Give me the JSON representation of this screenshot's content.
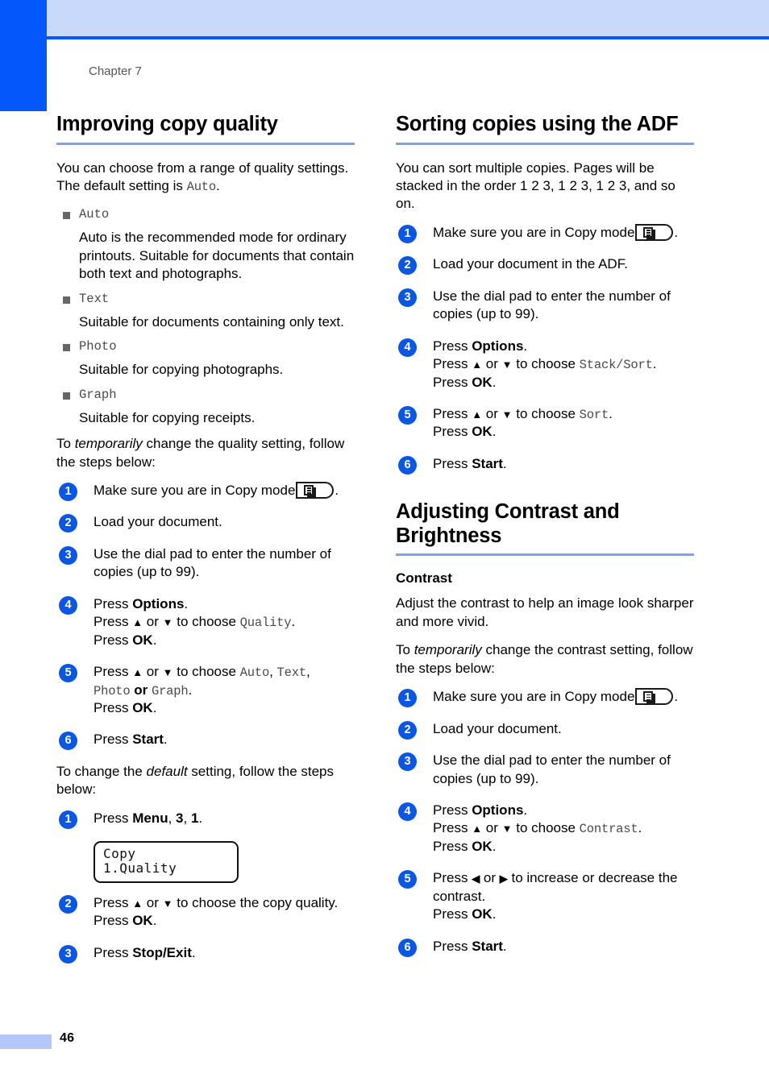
{
  "page": {
    "chapter_label": "Chapter 7",
    "page_number": "46",
    "accent_blue": "#0458fb",
    "header_band_blue": "#c9d9fb",
    "rule_blue": "#7ba3e8",
    "step_circle_blue": "#0b57e3",
    "footer_block_blue": "#b3c8f8"
  },
  "left_column": {
    "heading": "Improving copy quality",
    "intro_a": "You can choose from a range of quality settings. The default setting is ",
    "intro_a_mono": "Auto",
    "intro_a_end": ".",
    "quality_options": [
      {
        "name": "Auto",
        "description": "Auto is the recommended mode for ordinary printouts. Suitable for documents that contain both text and photographs."
      },
      {
        "name": "Text",
        "description": "Suitable for documents containing only text."
      },
      {
        "name": "Photo",
        "description": "Suitable for copying photographs."
      },
      {
        "name": "Graph",
        "description": "Suitable for copying receipts."
      }
    ],
    "temp_intro_pre": "To ",
    "temp_intro_em": "temporarily",
    "temp_intro_post": " change the quality setting, follow the steps below:",
    "temp_steps": {
      "s1": "Make sure you are in Copy mode",
      "s1_end": ".",
      "s2": "Load your document.",
      "s3": "Use the dial pad to enter the number of copies (up to 99).",
      "s4_l1_pre": "Press ",
      "s4_l1_b": "Options",
      "s4_l1_end": ".",
      "s4_l2_pre": "Press ",
      "s4_l2_mid": " or ",
      "s4_l2_post": " to choose ",
      "s4_l2_mono": "Quality",
      "s4_l2_end": ".",
      "s4_l3_pre": "Press ",
      "s4_l3_b": "OK",
      "s4_l3_end": ".",
      "s5_l1_pre": "Press ",
      "s5_l1_mid": " or ",
      "s5_l1_post": " to choose ",
      "s5_mono_1": "Auto",
      "s5_sep_1": ", ",
      "s5_mono_2": "Text",
      "s5_sep_2": ",",
      "s5_l2_mono_3": "Photo",
      "s5_l2_or": " or ",
      "s5_l2_mono_4": "Graph",
      "s5_l2_end": ".",
      "s5_l3_pre": "Press ",
      "s5_l3_b": "OK",
      "s5_l3_end": ".",
      "s6_pre": "Press ",
      "s6_b": "Start",
      "s6_end": "."
    },
    "default_intro_pre": "To change the ",
    "default_intro_em": "default",
    "default_intro_post": " setting, follow the steps below:",
    "default_steps": {
      "d1_pre": "Press ",
      "d1_b1": "Menu",
      "d1_sep1": ", ",
      "d1_b2": "3",
      "d1_sep2": ", ",
      "d1_b3": "1",
      "d1_end": ".",
      "lcd_line1": "Copy",
      "lcd_line2": "1.Quality",
      "d2_l1_pre": "Press ",
      "d2_l1_mid": " or ",
      "d2_l1_post": " to choose the copy quality.",
      "d2_l2_pre": "Press ",
      "d2_l2_b": "OK",
      "d2_l2_end": ".",
      "d3_pre": "Press ",
      "d3_b": "Stop/Exit",
      "d3_end": "."
    }
  },
  "right_column": {
    "heading_sort": "Sorting copies using the ADF",
    "sort_intro": "You can sort multiple copies. Pages will be stacked in the order 1 2 3, 1 2 3, 1 2 3, and so on.",
    "sort_steps": {
      "s1": "Make sure you are in Copy mode",
      "s1_end": ".",
      "s2": "Load your document in the ADF.",
      "s3": "Use the dial pad to enter the number of copies (up to 99).",
      "s4_l1_pre": "Press ",
      "s4_l1_b": "Options",
      "s4_l1_end": ".",
      "s4_l2_pre": "Press ",
      "s4_l2_mid": " or ",
      "s4_l2_post": " to choose ",
      "s4_l2_mono": "Stack/Sort",
      "s4_l2_end": ".",
      "s4_l3_pre": "Press ",
      "s4_l3_b": "OK",
      "s4_l3_end": ".",
      "s5_l1_pre": "Press ",
      "s5_l1_mid": " or ",
      "s5_l1_post": " to choose ",
      "s5_l1_mono": "Sort",
      "s5_l1_end": ".",
      "s5_l2_pre": "Press ",
      "s5_l2_b": "OK",
      "s5_l2_end": ".",
      "s6_pre": "Press ",
      "s6_b": "Start",
      "s6_end": "."
    },
    "heading_contrast": "Adjusting Contrast and Brightness",
    "subheading_contrast": "Contrast",
    "contrast_desc": "Adjust the contrast to help an image look sharper and more vivid.",
    "contrast_temp_pre": "To ",
    "contrast_temp_em": "temporarily",
    "contrast_temp_post": " change the contrast setting, follow the steps below:",
    "contrast_steps": {
      "c1": "Make sure you are in Copy mode",
      "c1_end": ".",
      "c2": "Load your document.",
      "c3": "Use the dial pad to enter the number of copies (up to 99).",
      "c4_l1_pre": "Press ",
      "c4_l1_b": "Options",
      "c4_l1_end": ".",
      "c4_l2_pre": "Press ",
      "c4_l2_mid": " or ",
      "c4_l2_post": " to choose ",
      "c4_l2_mono": "Contrast",
      "c4_l2_end": ".",
      "c4_l3_pre": "Press ",
      "c4_l3_b": "OK",
      "c4_l3_end": ".",
      "c5_l1_pre": "Press ",
      "c5_l1_mid": " or ",
      "c5_l1_post": " to increase or decrease the contrast.",
      "c5_l2_pre": "Press ",
      "c5_l2_b": "OK",
      "c5_l2_end": ".",
      "c6_pre": "Press ",
      "c6_b": "Start",
      "c6_end": "."
    }
  },
  "glyphs": {
    "up_arrow": "▲",
    "down_arrow": "▼",
    "left_arrow": "◀",
    "right_arrow": "▶",
    "step_numbers": [
      "1",
      "2",
      "3",
      "4",
      "5",
      "6"
    ]
  }
}
